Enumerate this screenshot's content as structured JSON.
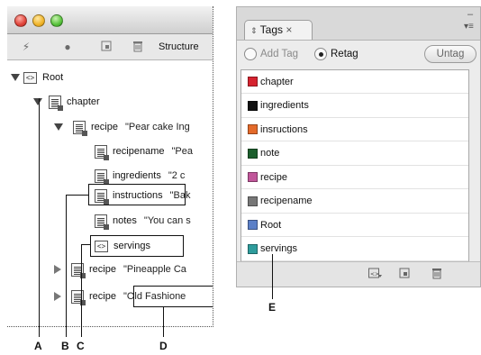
{
  "structure_panel": {
    "toolbar_label": "Structure",
    "tree": [
      {
        "name": "root",
        "label": "Root",
        "snippet": "",
        "icon": "code-element-icon",
        "expand": "down"
      },
      {
        "name": "chapter",
        "label": "chapter",
        "snippet": "",
        "icon": "story-element-icon",
        "expand": "down"
      },
      {
        "name": "recipe-1",
        "label": "recipe",
        "snippet": "\"Pear cake Ing",
        "icon": "text-element-icon",
        "expand": "down"
      },
      {
        "name": "recipename",
        "label": "recipename",
        "snippet": "\"Pea",
        "icon": "text-element-icon",
        "expand": ""
      },
      {
        "name": "ingredients",
        "label": "ingredients",
        "snippet": "\"2 c",
        "icon": "text-element-icon",
        "expand": ""
      },
      {
        "name": "instructions",
        "label": "instructions",
        "snippet": "\"Bak",
        "icon": "text-element-icon",
        "expand": ""
      },
      {
        "name": "notes",
        "label": "notes",
        "snippet": "\"You can s",
        "icon": "text-element-icon",
        "expand": ""
      },
      {
        "name": "servings",
        "label": "servings",
        "snippet": "",
        "icon": "code-element-icon",
        "expand": ""
      },
      {
        "name": "recipe-2",
        "label": "recipe",
        "snippet": "\"Pineapple Ca",
        "icon": "text-element-icon",
        "expand": "right"
      },
      {
        "name": "recipe-3",
        "label": "recipe",
        "snippet": "\"Old Fashione",
        "icon": "text-element-icon",
        "expand": "right"
      }
    ]
  },
  "tags_panel": {
    "tab_label": "Tags",
    "tab_close": "×",
    "add_tag_label": "Add Tag",
    "retag_label": "Retag",
    "untag_label": "Untag",
    "tags": [
      {
        "name": "chapter",
        "color": "#d6232f"
      },
      {
        "name": "ingredients",
        "color": "#111111"
      },
      {
        "name": "insructions",
        "color": "#e46a2a"
      },
      {
        "name": "note",
        "color": "#1b5e2c"
      },
      {
        "name": "recipe",
        "color": "#c1569a"
      },
      {
        "name": "recipename",
        "color": "#777777"
      },
      {
        "name": "Root",
        "color": "#5b7fc7"
      },
      {
        "name": "servings",
        "color": "#2e9c9c"
      }
    ]
  },
  "callouts": {
    "A": "A",
    "B": "B",
    "C": "C",
    "D": "D",
    "E": "E"
  }
}
